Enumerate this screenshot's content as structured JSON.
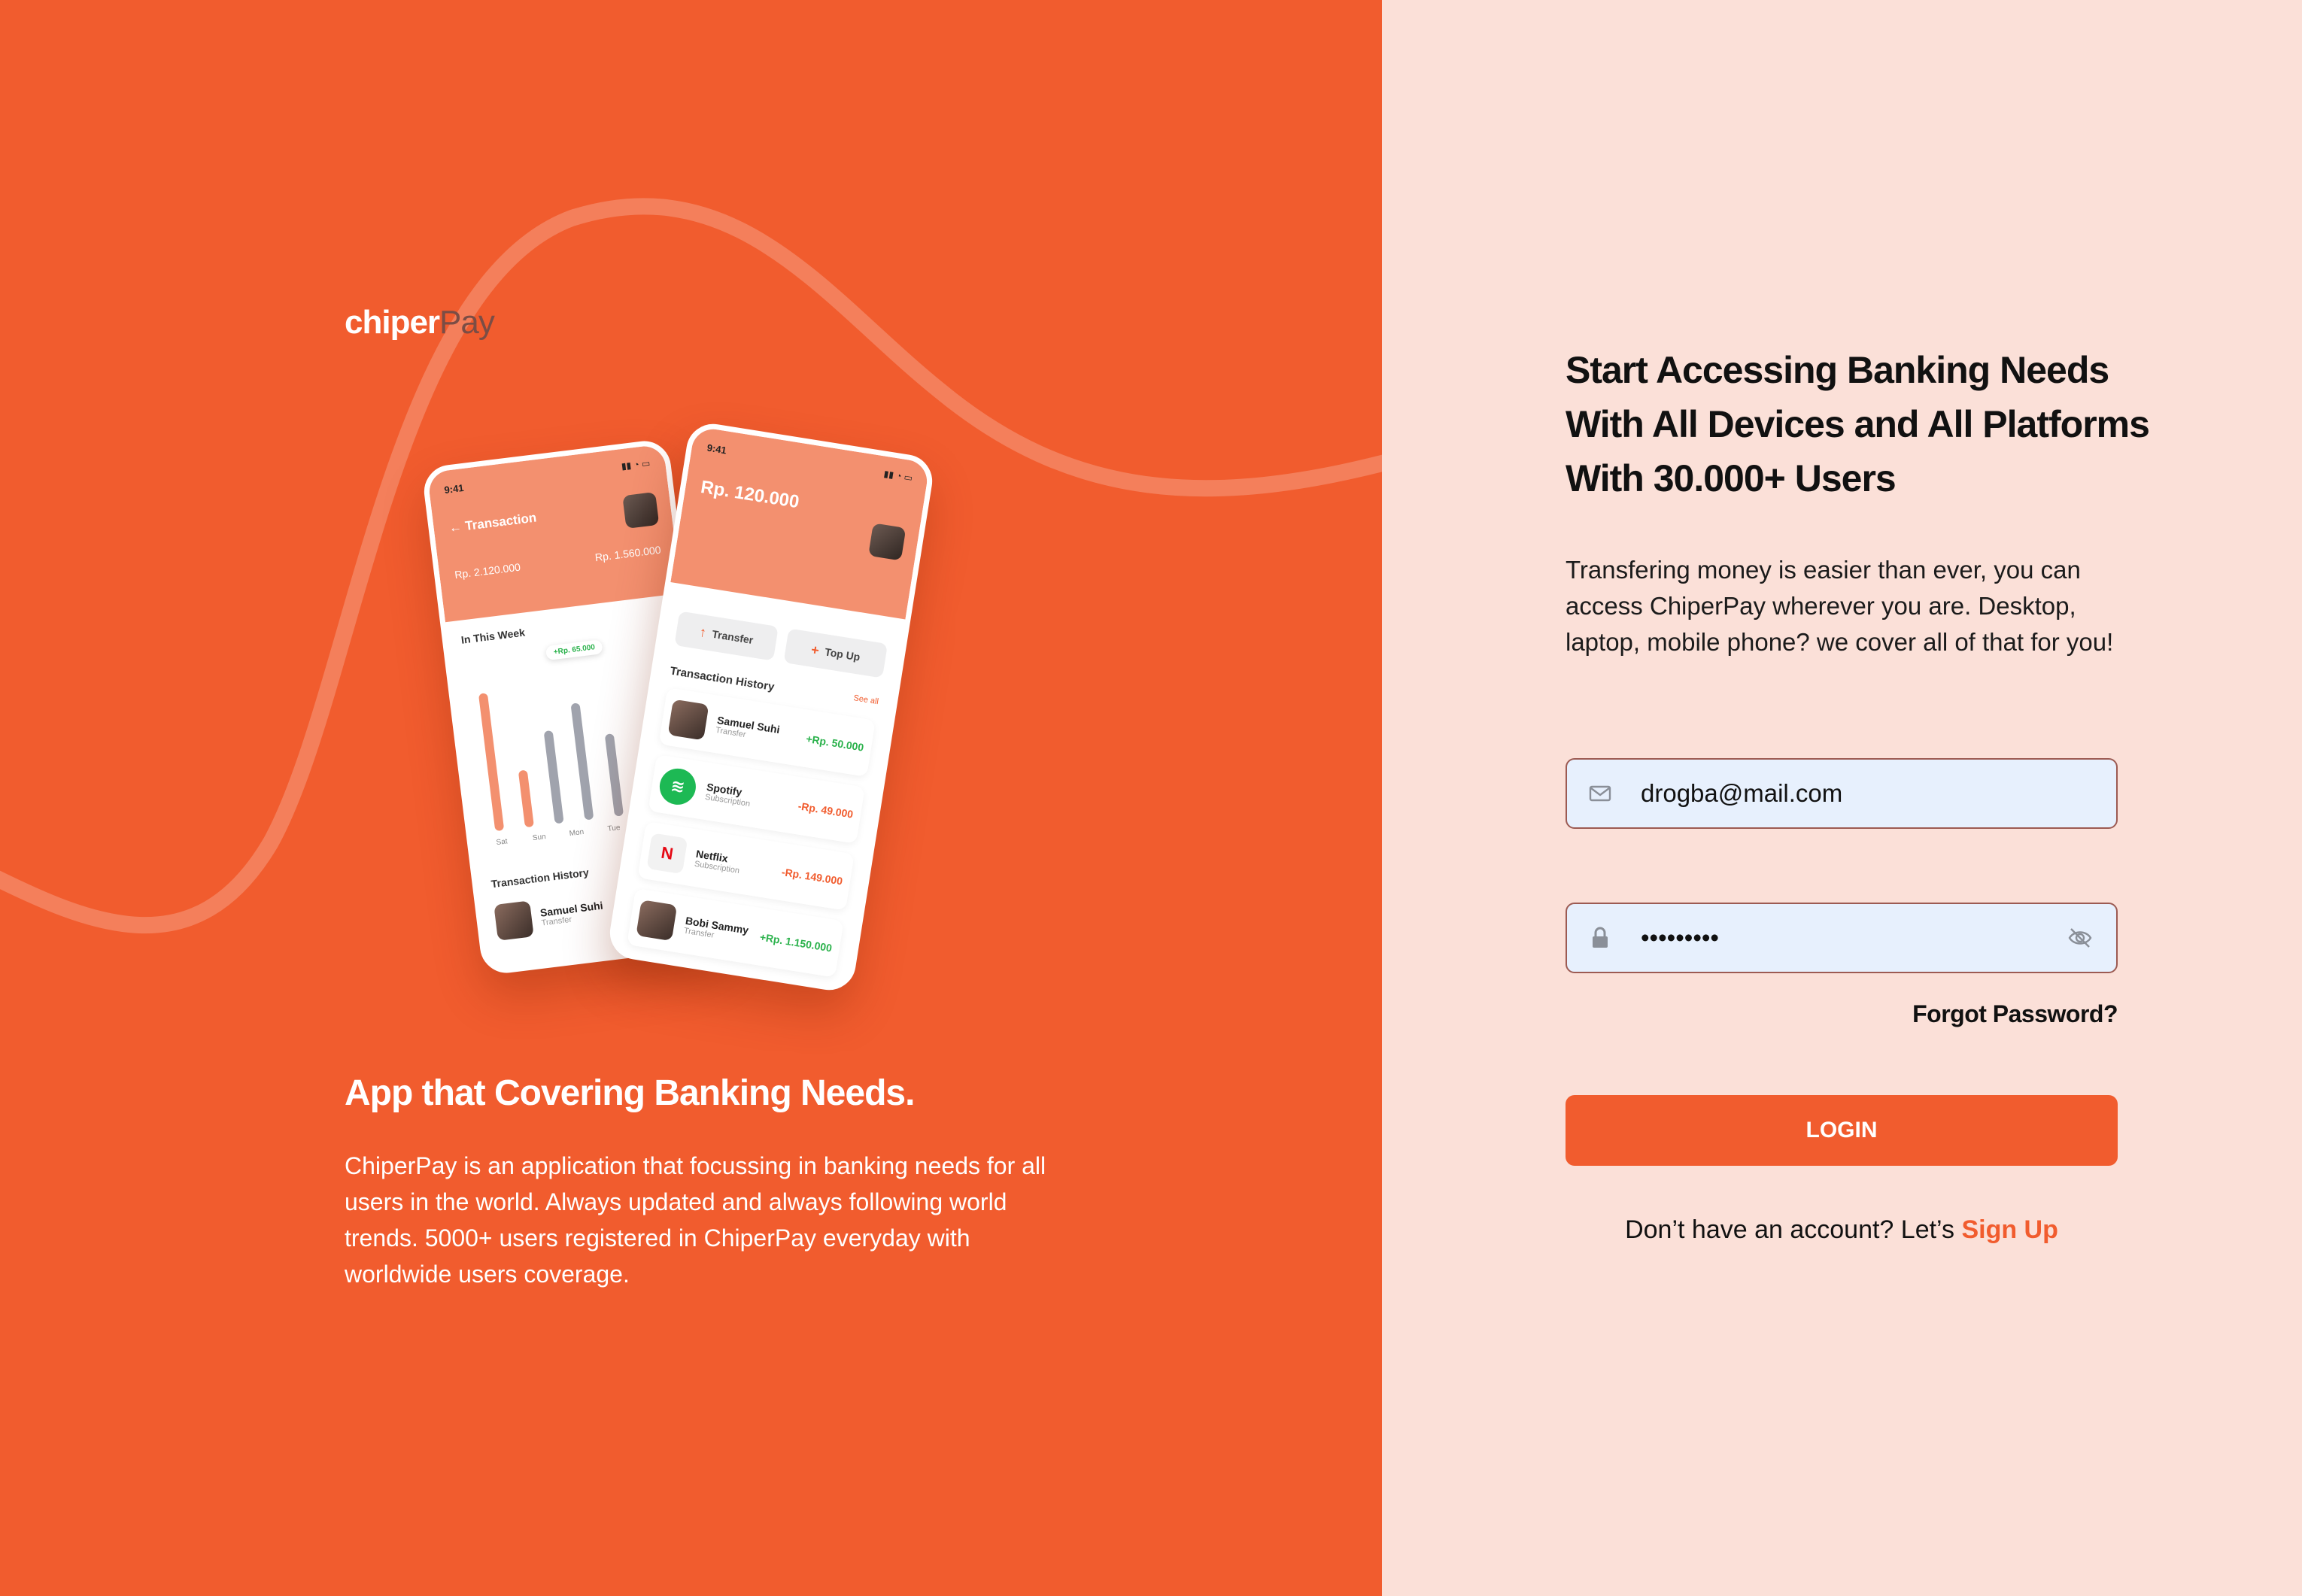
{
  "brand": {
    "name_part1": "chiper",
    "name_part2": "Pay"
  },
  "hero": {
    "title": "App that Covering Banking Needs.",
    "description": "ChiperPay is an application that focussing in banking needs for all users in the world. Always updated and always following world trends. 5000+ users registered in ChiperPay everyday with worldwide users coverage."
  },
  "phone_transaction": {
    "time": "9:41",
    "title": "Transaction",
    "income_value": "Rp. 2.120.000",
    "outcome_value": "Rp. 1.560.000",
    "week_label": "In This Week",
    "tooltip": "+Rp. 65.000",
    "days": [
      "Sat",
      "Sun",
      "Mon",
      "Tue"
    ],
    "bars": [
      {
        "level": 0.92,
        "color": "#f3906f"
      },
      {
        "level": 0.38,
        "color": "#f3906f"
      },
      {
        "level": 0.62,
        "color": "#a0a3ad"
      },
      {
        "level": 0.78,
        "color": "#a0a3ad"
      },
      {
        "level": 0.55,
        "color": "#a0a3ad"
      }
    ],
    "history_label": "Transaction History",
    "history_name": "Samuel Suhi",
    "history_type": "Transfer"
  },
  "phone_home": {
    "time": "9:41",
    "balance": "Rp. 120.000",
    "transfer_label": "Transfer",
    "topup_label": "Top Up",
    "history_label": "Transaction History",
    "see_all": "See all",
    "transactions": [
      {
        "name": "Samuel Suhi",
        "type": "Transfer",
        "amount": "+Rp. 50.000",
        "sign": "pos",
        "icon": "avatar"
      },
      {
        "name": "Spotify",
        "type": "Subscription",
        "amount": "-Rp. 49.000",
        "sign": "neg",
        "icon": "spotify"
      },
      {
        "name": "Netflix",
        "type": "Subscription",
        "amount": "-Rp. 149.000",
        "sign": "neg",
        "icon": "netflix"
      },
      {
        "name": "Bobi Sammy",
        "type": "Transfer",
        "amount": "+Rp. 1.150.000",
        "sign": "pos",
        "icon": "avatar"
      }
    ]
  },
  "login": {
    "title_line1": "Start Accessing Banking Needs",
    "title_line2": "With All Devices and All Platforms",
    "title_line3": "With 30.000+ Users",
    "description": "Transfering money is easier than ever, you can access ChiperPay wherever you are. Desktop, laptop, mobile phone? we cover all of that for you!",
    "email_value": "drogba@mail.com",
    "password_value": "•••••••••",
    "forgot_label": "Forgot Password?",
    "login_label": "LOGIN",
    "signup_prompt": "Don’t have an account? Let’s ",
    "signup_link": "Sign Up"
  },
  "colors": {
    "brand": "#f15c2e",
    "panel_bg": "#fbe0d8",
    "input_bg": "#e7f0fd",
    "input_border": "#9c5a52"
  }
}
